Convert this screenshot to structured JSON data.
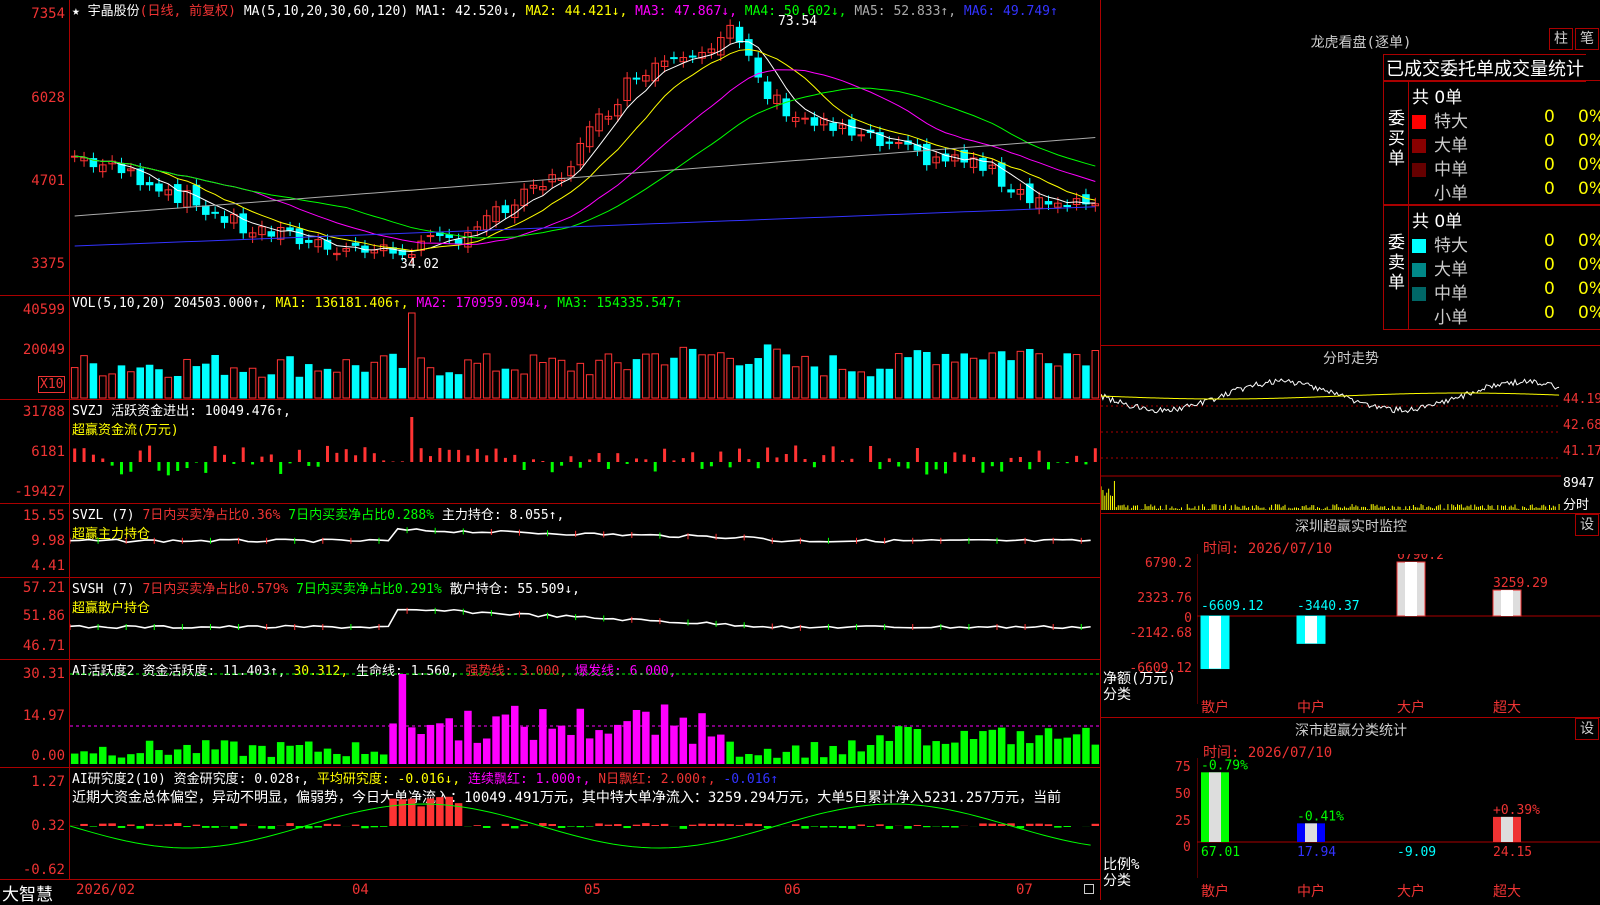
{
  "colors": {
    "up": "#ff3333",
    "down": "#00ffff",
    "grid": "#aa0000",
    "ma1": "#ffffff",
    "ma2": "#ffff00",
    "ma3": "#ff00ff",
    "ma4": "#00ff00",
    "ma5": "#aaaaaa",
    "ma6": "#3333ff"
  },
  "kline": {
    "stock": "宇晶股份",
    "mode": "(日线, 前复权)",
    "ma_label": "MA(5,10,20,30,60,120)",
    "ma1": "MA1: 42.520↓,",
    "ma2": "MA2: 44.421↓,",
    "ma3": "MA3: 47.867↓,",
    "ma4": "MA4: 50.602↓,",
    "ma5": "MA5: 52.833↑,",
    "ma6": "MA6: 49.749↑",
    "yticks": [
      "7354",
      "6028",
      "4701",
      "3375"
    ],
    "high_label": "73.54",
    "low_label": "34.02"
  },
  "vol": {
    "label": "VOL(5,10,20)",
    "value": "204503.000↑,",
    "ma1": "MA1: 136181.406↑,",
    "ma2": "MA2: 170959.094↓,",
    "ma3": "MA3: 154335.547↑",
    "yticks": [
      "40599",
      "20049"
    ],
    "unit": "X10"
  },
  "svzj": {
    "label": "SVZJ",
    "item": "活跃资金进出: 10049.476↑,",
    "sub": "超赢资金流(万元)",
    "yticks": [
      "31788",
      "6181",
      "-19427"
    ]
  },
  "svzl": {
    "label": "SVZL (7)",
    "a": "7日内买卖净占比0.36%",
    "b": "7日内买卖净占比0.288%",
    "c": "主力持仓: 8.055↑,",
    "sub": "超赢主力持仓",
    "yticks": [
      "15.55",
      "9.98",
      "4.41"
    ]
  },
  "svsh": {
    "label": "SVSH (7)",
    "a": "7日内买卖净占比0.579%",
    "b": "7日内买卖净占比0.291%",
    "c": "散户持仓: 55.509↓,",
    "sub": "超赢散户持仓",
    "yticks": [
      "57.21",
      "51.86",
      "46.71"
    ]
  },
  "ai1": {
    "label": "AI活跃度2",
    "a": "资金活跃度: 11.403↑,",
    "b": "30.312,",
    "c": "生命线: 1.560,",
    "d": "强势线: 3.000,",
    "e": "爆发线: 6.000,",
    "yticks": [
      "30.31",
      "14.97",
      "0.00"
    ]
  },
  "ai2": {
    "label": "AI研究度2(10)",
    "a": "资金研究度: 0.028↑,",
    "b": "平均研究度: -0.016↓,",
    "c": "连续飘红: 1.000↑,",
    "d": "N日飘红: 2.000↑,",
    "e": "-0.016↑",
    "text": "近期大资金总体偏空，异动不明显，偏弱势，今日大单净流入：10049.491万元，其中特大单净流入：3259.294万元，大单5日累计净入5231.257万元，当前",
    "yticks": [
      "1.27",
      "0.32",
      "-0.62"
    ]
  },
  "xaxis": {
    "brand": "大智慧",
    "labels": [
      "2026/02",
      "04",
      "05",
      "06",
      "07"
    ]
  },
  "lhb": {
    "title": "龙虎看盘(逐单)",
    "btn1": "柱",
    "btn2": "笔",
    "tabs": "已成交委托单成交量统计",
    "buy_side": "委买单",
    "sell_side": "委卖单",
    "buy_total": "共 0单",
    "sell_total": "共 0单",
    "rows": [
      {
        "name": "特大",
        "count": "0",
        "pct": "0%"
      },
      {
        "name": "大单",
        "count": "0",
        "pct": "0%"
      },
      {
        "name": "中单",
        "count": "0",
        "pct": "0%"
      },
      {
        "name": "小单",
        "count": "0",
        "pct": "0%"
      }
    ]
  },
  "fenshi": {
    "title": "分时走势",
    "yticks": [
      "44.19",
      "42.68",
      "41.17"
    ],
    "vol_tick": "8947",
    "unit": "分时"
  },
  "sz_monitor": {
    "title": "深圳超赢实时监控",
    "btn": "设",
    "time": "时间: 2026/07/10",
    "yticks": [
      "6790.2",
      "2323.76",
      "0",
      "-2142.68",
      "-6609.12"
    ],
    "ylabel": "净额(万元)",
    "xlabel": "分类",
    "categories": [
      "散户",
      "中户",
      "大户",
      "超大"
    ],
    "values": [
      "-6609.12",
      "-3440.37",
      "6790.2",
      "3259.29"
    ]
  },
  "sz_class": {
    "title": "深市超赢分类统计",
    "btn": "设",
    "time": "时间: 2026/07/10",
    "yticks": [
      "75",
      "50",
      "25",
      "0"
    ],
    "ylabel": "比例%",
    "xlabel": "分类",
    "categories": [
      "散户",
      "中户",
      "大户",
      "超大"
    ],
    "pct_labels": [
      "-0.79%",
      "-0.41%",
      "",
      "+0.39%"
    ],
    "values": [
      "67.01",
      "17.94",
      "-9.09",
      "24.15"
    ]
  }
}
